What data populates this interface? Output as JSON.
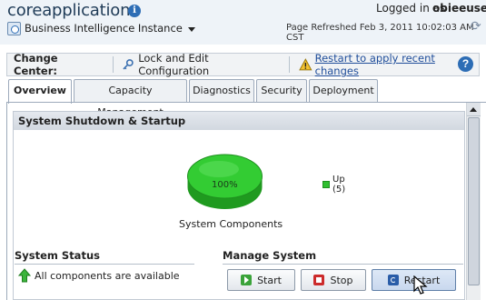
{
  "header": {
    "title": "coreapplication",
    "info_icon": "info-icon",
    "logged_in_label": "Logged in as",
    "user": "obieeuser",
    "instance_label": "Business Intelligence Instance",
    "refreshed": "Page Refreshed Feb 3, 2011 10:02:03 AM CST",
    "refresh_icon": "refresh-icon"
  },
  "change_center": {
    "label": "Change Center:",
    "lock_label": "Lock and Edit Configuration",
    "restart_link": "Restart to apply recent changes",
    "help_icon": "help-icon",
    "help_glyph": "?"
  },
  "tabs": [
    {
      "label": "Overview",
      "active": true
    },
    {
      "label": "Capacity Management",
      "active": false
    },
    {
      "label": "Diagnostics",
      "active": false
    },
    {
      "label": "Security",
      "active": false
    },
    {
      "label": "Deployment",
      "active": false
    }
  ],
  "panel": {
    "title": "System Shutdown & Startup",
    "chart_caption": "System Components"
  },
  "chart_data": {
    "type": "pie",
    "slices": [
      {
        "label": "Up",
        "value": 5,
        "percent": "100%",
        "color": "#2fbf2f"
      }
    ],
    "legend": [
      {
        "name": "Up",
        "count": "(5)"
      }
    ],
    "title": "System Components"
  },
  "status": {
    "title": "System Status",
    "text": "All components are available",
    "icon": "arrow-up-icon"
  },
  "manage": {
    "title": "Manage System",
    "start_label": "Start",
    "stop_label": "Stop",
    "restart_label": "Restart"
  },
  "colors": {
    "accent": "#2d6db5",
    "up_green": "#2fbf2f",
    "stop_red": "#cc2b2b"
  }
}
